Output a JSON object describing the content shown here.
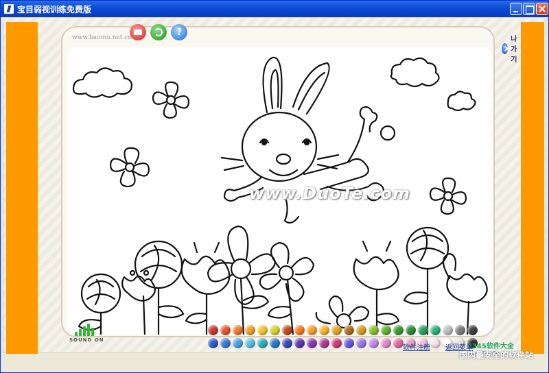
{
  "window": {
    "title": "宝目弱视训练免费版"
  },
  "board": {
    "site_url": "www.baomu.net.cn",
    "exit_label": "나가기",
    "watermark": "www.DuoTe.com"
  },
  "sound": {
    "label": "SOUND ON"
  },
  "toolbar": {
    "help_symbol": "?"
  },
  "palette": {
    "row1": [
      "#d0392f",
      "#e8572a",
      "#ef7a2a",
      "#f3a02a",
      "#f5c72a",
      "#d9d22a",
      "#c84a1f",
      "#ff7a1a",
      "#ff9a2a",
      "#ffb32a",
      "#e6a420",
      "#b37020",
      "#d8a020",
      "#8bbf2a",
      "#5fb32a",
      "#3c9e2a",
      "#2a8e3c",
      "#2aa05a",
      "#2ab37a",
      "#c0c0c0",
      "#808080",
      "#404040"
    ],
    "row2": [
      "#2a5fd0",
      "#3a7ae0",
      "#4aa0e8",
      "#5cc0e8",
      "#2ab0c0",
      "#2a7ad0",
      "#3a4ac0",
      "#5a3ab0",
      "#8a3ab0",
      "#b03a9a",
      "#d03a7a",
      "#6a5ae0",
      "#9a7ae8",
      "#c08ae8",
      "#e08ac8",
      "#e06aa0",
      "#e8a0c0",
      "#f0c0d8",
      "#f8e0e8",
      "#ffffff",
      "#e0e0e0",
      "#303030"
    ]
  },
  "footer": {
    "register": "软件注册",
    "back_menu": "返回菜单"
  },
  "branding": {
    "logo": "2345软件大全",
    "site": "www.DuoTe.com",
    "slogan": "国内最安全的软件站"
  }
}
